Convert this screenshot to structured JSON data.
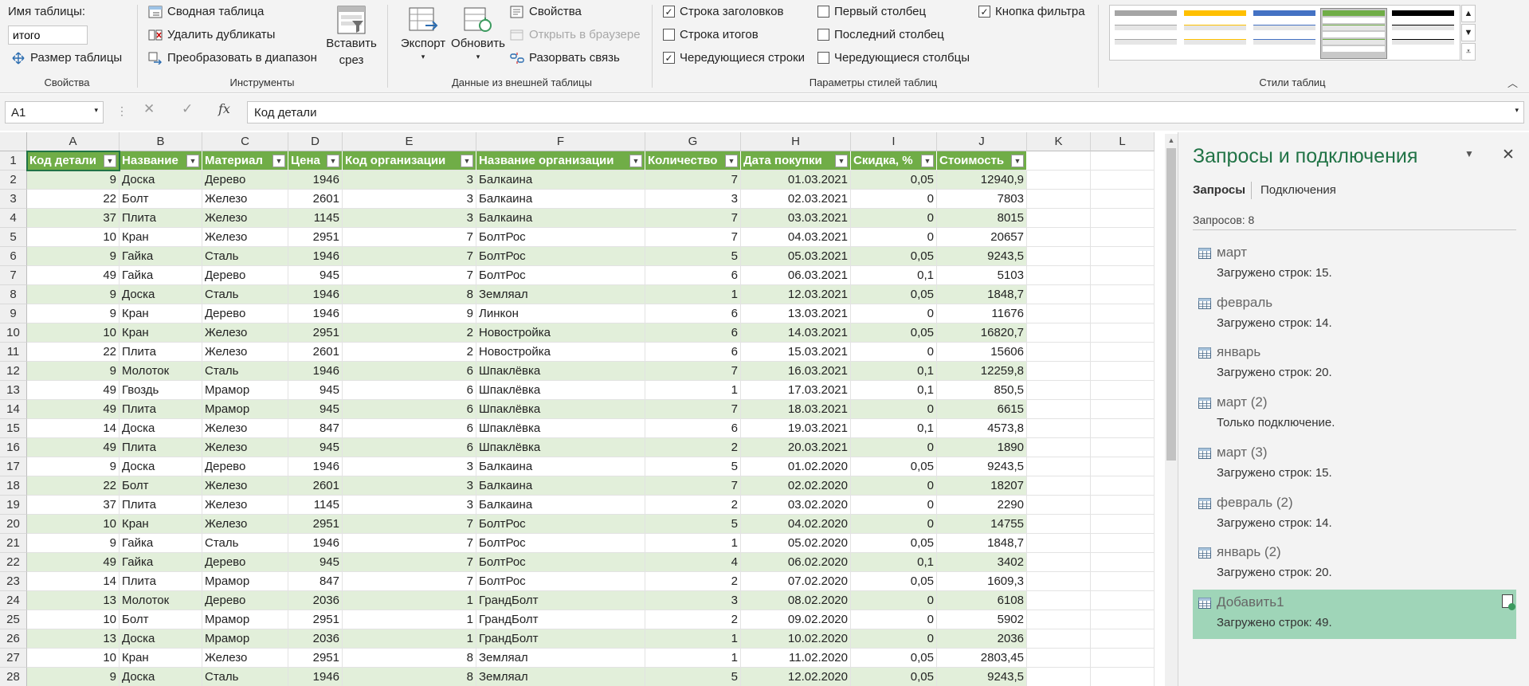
{
  "ribbon": {
    "properties": {
      "table_name_label": "Имя таблицы:",
      "table_name_value": "итого",
      "resize_label": "Размер таблицы",
      "group_label": "Свойства"
    },
    "tools": {
      "pivot_label": "Сводная таблица",
      "remove_dup_label": "Удалить дубликаты",
      "convert_label": "Преобразовать в диапазон",
      "slicer_label": "Вставить срез",
      "group_label": "Инструменты"
    },
    "external": {
      "export_label": "Экспорт",
      "refresh_label": "Обновить",
      "properties_label": "Свойства",
      "open_browser_label": "Открыть в браузере",
      "unlink_label": "Разорвать связь",
      "group_label": "Данные из внешней таблицы"
    },
    "style_options": {
      "header_row": {
        "label": "Строка заголовков",
        "checked": true
      },
      "total_row": {
        "label": "Строка итогов",
        "checked": false
      },
      "banded_rows": {
        "label": "Чередующиеся строки",
        "checked": true
      },
      "first_column": {
        "label": "Первый столбец",
        "checked": false
      },
      "last_column": {
        "label": "Последний столбец",
        "checked": false
      },
      "banded_columns": {
        "label": "Чередующиеся столбцы",
        "checked": false
      },
      "filter_button": {
        "label": "Кнопка фильтра",
        "checked": true
      },
      "group_label": "Параметры стилей таблиц"
    },
    "table_styles": {
      "group_label": "Стили таблиц",
      "swatches": [
        "#a5a5a5",
        "#ffc000",
        "#4472c4",
        "#70ad47",
        "#000000"
      ],
      "selected_index": 3
    }
  },
  "formula_bar": {
    "name_box": "A1",
    "formula": "Код детали",
    "fx": "fx"
  },
  "sheet": {
    "columns": [
      "A",
      "B",
      "C",
      "D",
      "E",
      "F",
      "G",
      "H",
      "I",
      "J",
      "K",
      "L"
    ],
    "row_numbers": [
      "1",
      "2",
      "3",
      "4",
      "5",
      "6",
      "7",
      "8",
      "9",
      "10",
      "11",
      "12",
      "13",
      "14",
      "15",
      "16",
      "17",
      "18",
      "19",
      "20",
      "21",
      "22",
      "23",
      "24",
      "25",
      "26",
      "27",
      "28"
    ],
    "headers": [
      "Код детали",
      "Название",
      "Материал",
      "Цена",
      "Код организации",
      "Название организации",
      "Количество",
      "Дата покупки",
      "Скидка, %",
      "Стоимость"
    ],
    "rows": [
      [
        "9",
        "Доска",
        "Дерево",
        "1946",
        "3",
        "Балкаина",
        "7",
        "01.03.2021",
        "0,05",
        "12940,9"
      ],
      [
        "22",
        "Болт",
        "Железо",
        "2601",
        "3",
        "Балкаина",
        "3",
        "02.03.2021",
        "0",
        "7803"
      ],
      [
        "37",
        "Плита",
        "Железо",
        "1145",
        "3",
        "Балкаина",
        "7",
        "03.03.2021",
        "0",
        "8015"
      ],
      [
        "10",
        "Кран",
        "Железо",
        "2951",
        "7",
        "БолтРос",
        "7",
        "04.03.2021",
        "0",
        "20657"
      ],
      [
        "9",
        "Гайка",
        "Сталь",
        "1946",
        "7",
        "БолтРос",
        "5",
        "05.03.2021",
        "0,05",
        "9243,5"
      ],
      [
        "49",
        "Гайка",
        "Дерево",
        "945",
        "7",
        "БолтРос",
        "6",
        "06.03.2021",
        "0,1",
        "5103"
      ],
      [
        "9",
        "Доска",
        "Сталь",
        "1946",
        "8",
        "Земляал",
        "1",
        "12.03.2021",
        "0,05",
        "1848,7"
      ],
      [
        "9",
        "Кран",
        "Дерево",
        "1946",
        "9",
        "Линкон",
        "6",
        "13.03.2021",
        "0",
        "11676"
      ],
      [
        "10",
        "Кран",
        "Железо",
        "2951",
        "2",
        "Новостройка",
        "6",
        "14.03.2021",
        "0,05",
        "16820,7"
      ],
      [
        "22",
        "Плита",
        "Железо",
        "2601",
        "2",
        "Новостройка",
        "6",
        "15.03.2021",
        "0",
        "15606"
      ],
      [
        "9",
        "Молоток",
        "Сталь",
        "1946",
        "6",
        "Шпаклёвка",
        "7",
        "16.03.2021",
        "0,1",
        "12259,8"
      ],
      [
        "49",
        "Гвоздь",
        "Мрамор",
        "945",
        "6",
        "Шпаклёвка",
        "1",
        "17.03.2021",
        "0,1",
        "850,5"
      ],
      [
        "49",
        "Плита",
        "Мрамор",
        "945",
        "6",
        "Шпаклёвка",
        "7",
        "18.03.2021",
        "0",
        "6615"
      ],
      [
        "14",
        "Доска",
        "Железо",
        "847",
        "6",
        "Шпаклёвка",
        "6",
        "19.03.2021",
        "0,1",
        "4573,8"
      ],
      [
        "49",
        "Плита",
        "Железо",
        "945",
        "6",
        "Шпаклёвка",
        "2",
        "20.03.2021",
        "0",
        "1890"
      ],
      [
        "9",
        "Доска",
        "Дерево",
        "1946",
        "3",
        "Балкаина",
        "5",
        "01.02.2020",
        "0,05",
        "9243,5"
      ],
      [
        "22",
        "Болт",
        "Железо",
        "2601",
        "3",
        "Балкаина",
        "7",
        "02.02.2020",
        "0",
        "18207"
      ],
      [
        "37",
        "Плита",
        "Железо",
        "1145",
        "3",
        "Балкаина",
        "2",
        "03.02.2020",
        "0",
        "2290"
      ],
      [
        "10",
        "Кран",
        "Железо",
        "2951",
        "7",
        "БолтРос",
        "5",
        "04.02.2020",
        "0",
        "14755"
      ],
      [
        "9",
        "Гайка",
        "Сталь",
        "1946",
        "7",
        "БолтРос",
        "1",
        "05.02.2020",
        "0,05",
        "1848,7"
      ],
      [
        "49",
        "Гайка",
        "Дерево",
        "945",
        "7",
        "БолтРос",
        "4",
        "06.02.2020",
        "0,1",
        "3402"
      ],
      [
        "14",
        "Плита",
        "Мрамор",
        "847",
        "7",
        "БолтРос",
        "2",
        "07.02.2020",
        "0,05",
        "1609,3"
      ],
      [
        "13",
        "Молоток",
        "Дерево",
        "2036",
        "1",
        "ГрандБолт",
        "3",
        "08.02.2020",
        "0",
        "6108"
      ],
      [
        "10",
        "Болт",
        "Мрамор",
        "2951",
        "1",
        "ГрандБолт",
        "2",
        "09.02.2020",
        "0",
        "5902"
      ],
      [
        "13",
        "Доска",
        "Мрамор",
        "2036",
        "1",
        "ГрандБолт",
        "1",
        "10.02.2020",
        "0",
        "2036"
      ],
      [
        "10",
        "Кран",
        "Железо",
        "2951",
        "8",
        "Земляал",
        "1",
        "11.02.2020",
        "0,05",
        "2803,45"
      ],
      [
        "9",
        "Доска",
        "Сталь",
        "1946",
        "8",
        "Земляал",
        "5",
        "12.02.2020",
        "0,05",
        "9243,5"
      ]
    ],
    "numeric_columns": [
      0,
      3,
      4,
      6,
      7,
      8,
      9
    ]
  },
  "pane": {
    "title": "Запросы и подключения",
    "tabs": [
      "Запросы",
      "Подключения"
    ],
    "count_label": "Запросов: 8",
    "queries": [
      {
        "name": "март",
        "status": "Загружено строк: 15."
      },
      {
        "name": "февраль",
        "status": "Загружено строк: 14."
      },
      {
        "name": "январь",
        "status": "Загружено строк: 20."
      },
      {
        "name": "март (2)",
        "status": "Только подключение."
      },
      {
        "name": "март (3)",
        "status": "Загружено строк: 15."
      },
      {
        "name": "февраль (2)",
        "status": "Загружено строк: 14."
      },
      {
        "name": "январь (2)",
        "status": "Загружено строк: 20."
      },
      {
        "name": "Добавить1",
        "status": "Загружено строк: 49."
      }
    ],
    "selected_index": 7,
    "selected_color": "#9fd5b8"
  }
}
